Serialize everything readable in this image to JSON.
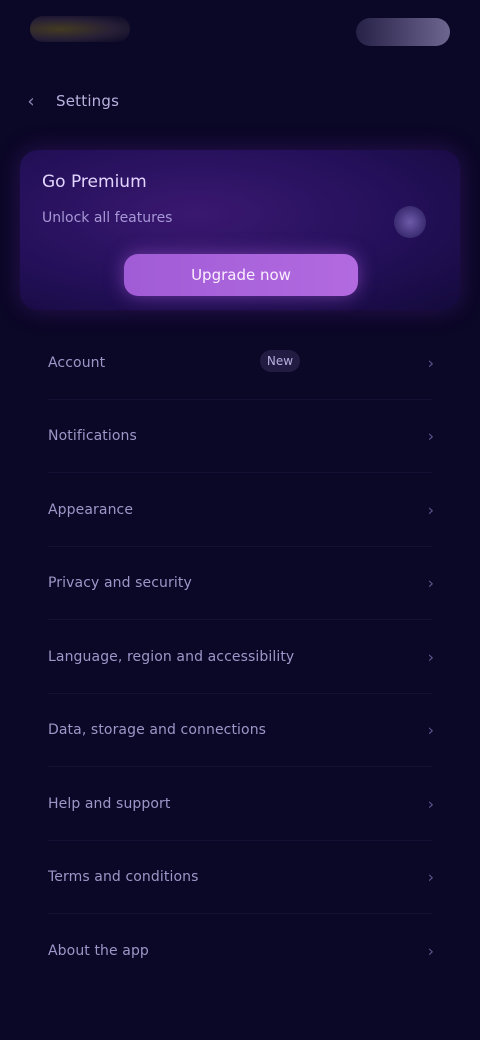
{
  "header": {
    "logo_label": "",
    "right_label": ""
  },
  "nav": {
    "back_label": "Settings"
  },
  "promo": {
    "title": "Go Premium",
    "subtitle": "Unlock all features",
    "button_label": "Upgrade now",
    "icon": "crown-icon"
  },
  "menu": {
    "items": [
      {
        "label": "Account",
        "badge": "New"
      },
      {
        "label": "Notifications",
        "badge": ""
      },
      {
        "label": "Appearance",
        "badge": ""
      },
      {
        "label": "Privacy and security",
        "badge": ""
      },
      {
        "label": "Language, region and accessibility",
        "badge": ""
      },
      {
        "label": "Data, storage and connections",
        "badge": ""
      },
      {
        "label": "Help and support",
        "badge": ""
      },
      {
        "label": "Terms and conditions",
        "badge": ""
      },
      {
        "label": "About the app",
        "badge": ""
      }
    ]
  },
  "colors": {
    "background": "#0b0726",
    "accent": "#a05cd6",
    "card": "#24105a"
  }
}
